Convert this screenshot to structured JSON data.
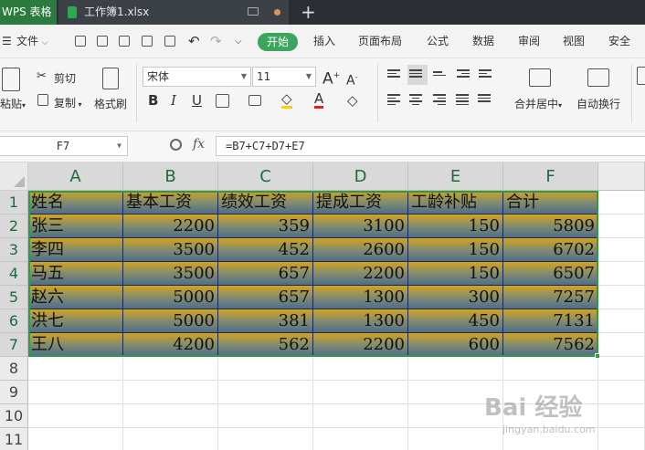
{
  "titlebar": {
    "app_tab": "WPS 表格",
    "file_tab": "工作簿1.xlsx",
    "add_tab": "+"
  },
  "menubar": {
    "file_menu": "文件",
    "items": [
      "开始",
      "插入",
      "页面布局",
      "公式",
      "数据",
      "审阅",
      "视图",
      "安全"
    ]
  },
  "ribbon": {
    "paste": "粘贴",
    "cut": "剪切",
    "copy": "复制",
    "format_painter": "格式刷",
    "font_name": "宋体",
    "font_size": "11",
    "merge_center": "合并居中",
    "wrap_text": "自动换行"
  },
  "formula_bar": {
    "name_box": "F7",
    "fx_label": "fx",
    "formula": "=B7+C7+D7+E7"
  },
  "sheet": {
    "columns": [
      "A",
      "B",
      "C",
      "D",
      "E",
      "F"
    ],
    "rows": [
      "1",
      "2",
      "3",
      "4",
      "5",
      "6",
      "7",
      "8",
      "9",
      "10",
      "11"
    ],
    "headers": [
      "姓名",
      "基本工资",
      "绩效工资",
      "提成工资",
      "工龄补贴",
      "合计"
    ],
    "data": [
      [
        "张三",
        "2200",
        "359",
        "3100",
        "150",
        "5809"
      ],
      [
        "李四",
        "3500",
        "452",
        "2600",
        "150",
        "6702"
      ],
      [
        "马五",
        "3500",
        "657",
        "2200",
        "150",
        "6507"
      ],
      [
        "赵六",
        "5000",
        "657",
        "1300",
        "300",
        "7257"
      ],
      [
        "洪七",
        "5000",
        "381",
        "1300",
        "450",
        "7131"
      ],
      [
        "王八",
        "4200",
        "562",
        "2200",
        "600",
        "7562"
      ]
    ],
    "selected_cell": "F7"
  },
  "watermark": {
    "main": "Bai 经验",
    "sub": "jingyan.baidu.com"
  }
}
